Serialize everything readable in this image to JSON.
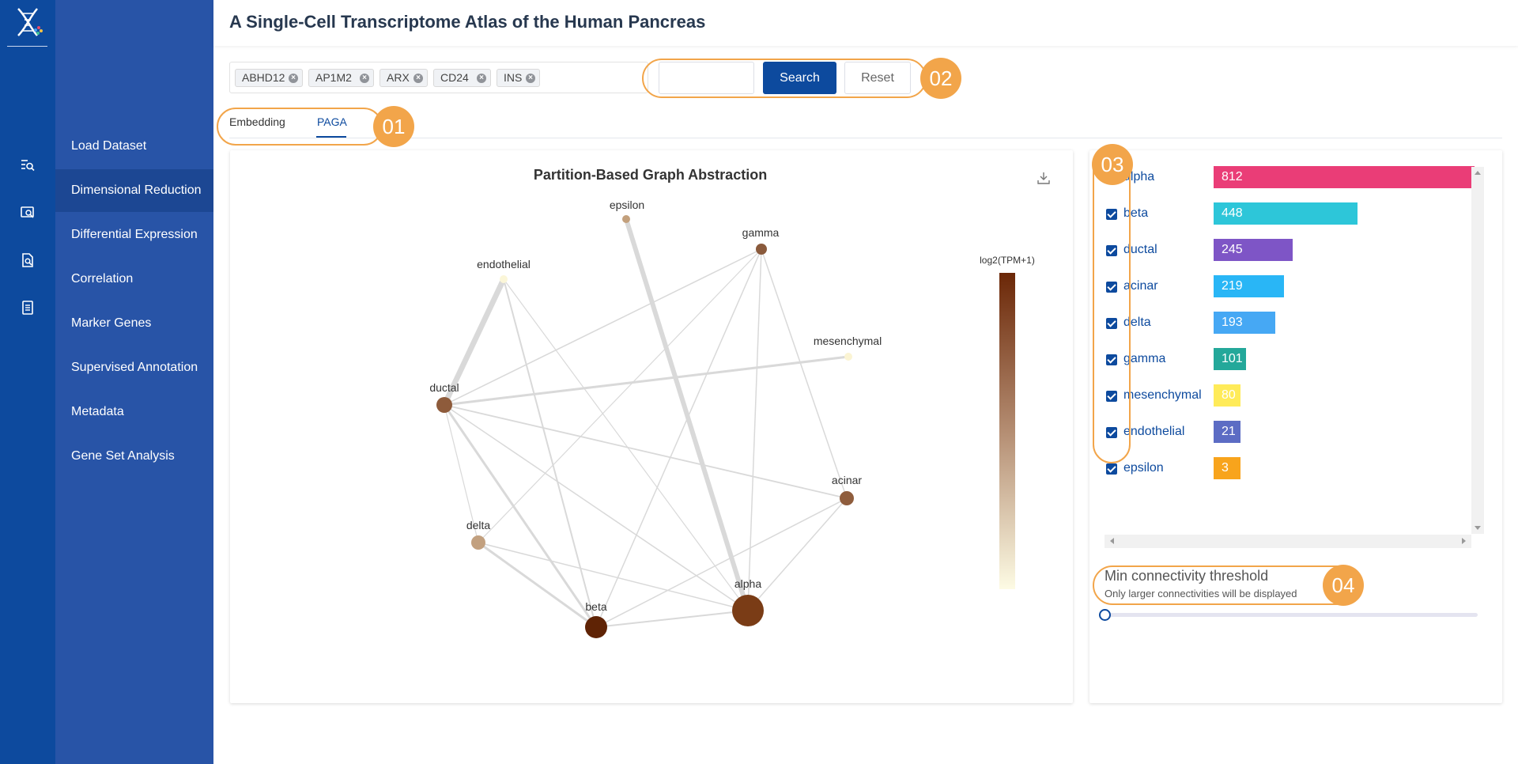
{
  "header": {
    "title": "A Single-Cell Transcriptome Atlas of the Human Pancreas"
  },
  "sidebar": {
    "items": [
      {
        "label": "Load Dataset",
        "active": false
      },
      {
        "label": "Dimensional Reduction",
        "active": true
      },
      {
        "label": "Differential Expression",
        "active": false
      },
      {
        "label": "Correlation",
        "active": false
      },
      {
        "label": "Marker Genes",
        "active": false
      },
      {
        "label": "Supervised Annotation",
        "active": false
      },
      {
        "label": "Metadata",
        "active": false
      },
      {
        "label": "Gene Set Analysis",
        "active": false
      }
    ]
  },
  "rail_icons": [
    "search-list-icon",
    "screen-search-icon",
    "document-search-icon",
    "document-list-icon"
  ],
  "search": {
    "tags": [
      "ABHD12",
      "AP1M2",
      "ARX",
      "CD24",
      "INS"
    ],
    "query": "",
    "search_label": "Search",
    "reset_label": "Reset"
  },
  "tabs": [
    {
      "label": "Embedding",
      "active": false
    },
    {
      "label": "PAGA",
      "active": true
    }
  ],
  "callouts": [
    "01",
    "02",
    "03",
    "04"
  ],
  "paga": {
    "title": "Partition-Based Graph Abstraction",
    "colorbar_label": "log2(TPM+1)",
    "nodes": [
      {
        "name": "epsilon",
        "color": "#c3a07c"
      },
      {
        "name": "gamma",
        "color": "#8a5a3c"
      },
      {
        "name": "endothelial",
        "color": "#fbf6d8"
      },
      {
        "name": "mesenchymal",
        "color": "#fbf4d3"
      },
      {
        "name": "ductal",
        "color": "#8e5b3b"
      },
      {
        "name": "acinar",
        "color": "#8f5d3d"
      },
      {
        "name": "delta",
        "color": "#c2a07f"
      },
      {
        "name": "alpha",
        "color": "#7a3c16"
      },
      {
        "name": "beta",
        "color": "#5f2305"
      }
    ]
  },
  "cluster_counts": {
    "items": [
      {
        "name": "alpha",
        "value": 812,
        "color": "#ea3d77",
        "checked": true
      },
      {
        "name": "beta",
        "value": 448,
        "color": "#2dc6d9",
        "checked": true
      },
      {
        "name": "ductal",
        "value": 245,
        "color": "#7e55c6",
        "checked": true
      },
      {
        "name": "acinar",
        "value": 219,
        "color": "#29b6f6",
        "checked": true
      },
      {
        "name": "delta",
        "value": 193,
        "color": "#46a8f4",
        "checked": true
      },
      {
        "name": "gamma",
        "value": 101,
        "color": "#24a89a",
        "checked": true
      },
      {
        "name": "mesenchymal",
        "value": 80,
        "color": "#ffeb59",
        "checked": true
      },
      {
        "name": "endothelial",
        "value": 21,
        "color": "#5c6cc4",
        "checked": true
      },
      {
        "name": "epsilon",
        "value": 3,
        "color": "#f8a41c",
        "checked": true
      }
    ],
    "max": 812
  },
  "threshold": {
    "title": "Min connectivity threshold",
    "subtitle": "Only larger connectivities will be displayed",
    "value": 0
  }
}
